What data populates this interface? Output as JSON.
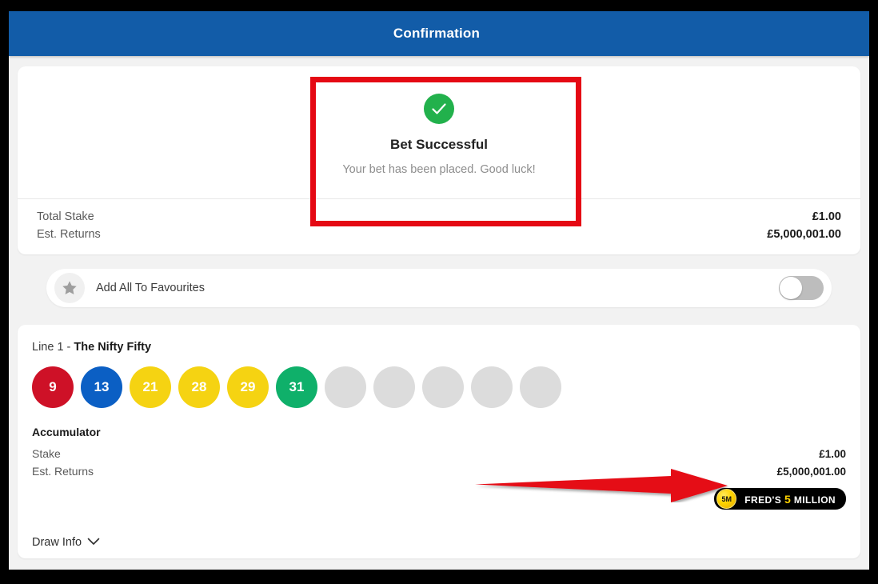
{
  "header": {
    "title": "Confirmation"
  },
  "success": {
    "icon": "check-circle-icon",
    "title": "Bet Successful",
    "subtitle": "Your bet has been placed. Good luck!"
  },
  "totals": [
    {
      "label": "Total Stake",
      "value": "£1.00"
    },
    {
      "label": "Est. Returns",
      "value": "£5,000,001.00"
    }
  ],
  "favourites": {
    "icon": "star-icon",
    "label": "Add All To Favourites",
    "toggle_state": "off"
  },
  "line": {
    "prefix": "Line 1 - ",
    "name": "The Nifty Fifty",
    "balls": [
      {
        "number": "9",
        "color": "#CE1127"
      },
      {
        "number": "13",
        "color": "#0B5FC4"
      },
      {
        "number": "21",
        "color": "#F5D312"
      },
      {
        "number": "28",
        "color": "#F5D312"
      },
      {
        "number": "29",
        "color": "#F5D312"
      },
      {
        "number": "31",
        "color": "#0FB06A"
      },
      {
        "number": "",
        "color": "#dcdcdc"
      },
      {
        "number": "",
        "color": "#dcdcdc"
      },
      {
        "number": "",
        "color": "#dcdcdc"
      },
      {
        "number": "",
        "color": "#dcdcdc"
      },
      {
        "number": "",
        "color": "#dcdcdc"
      }
    ],
    "accumulator_title": "Accumulator",
    "accumulator_rows": [
      {
        "label": "Stake",
        "value": "£1.00"
      },
      {
        "label": "Est. Returns",
        "value": "£5,000,001.00"
      }
    ]
  },
  "promo": {
    "coin_text": "5M",
    "word1": "FRED'S",
    "word2": "5",
    "word3": "MILLION"
  },
  "draw_info": {
    "label": "Draw Info",
    "chevron": "chevron-down-icon"
  },
  "annotations": {
    "rect_color": "#e50914",
    "arrow_color": "#e50914"
  },
  "colors": {
    "header_blue": "#125CA8",
    "success_green": "#22B14C",
    "page_background": "#f2f2f2"
  }
}
